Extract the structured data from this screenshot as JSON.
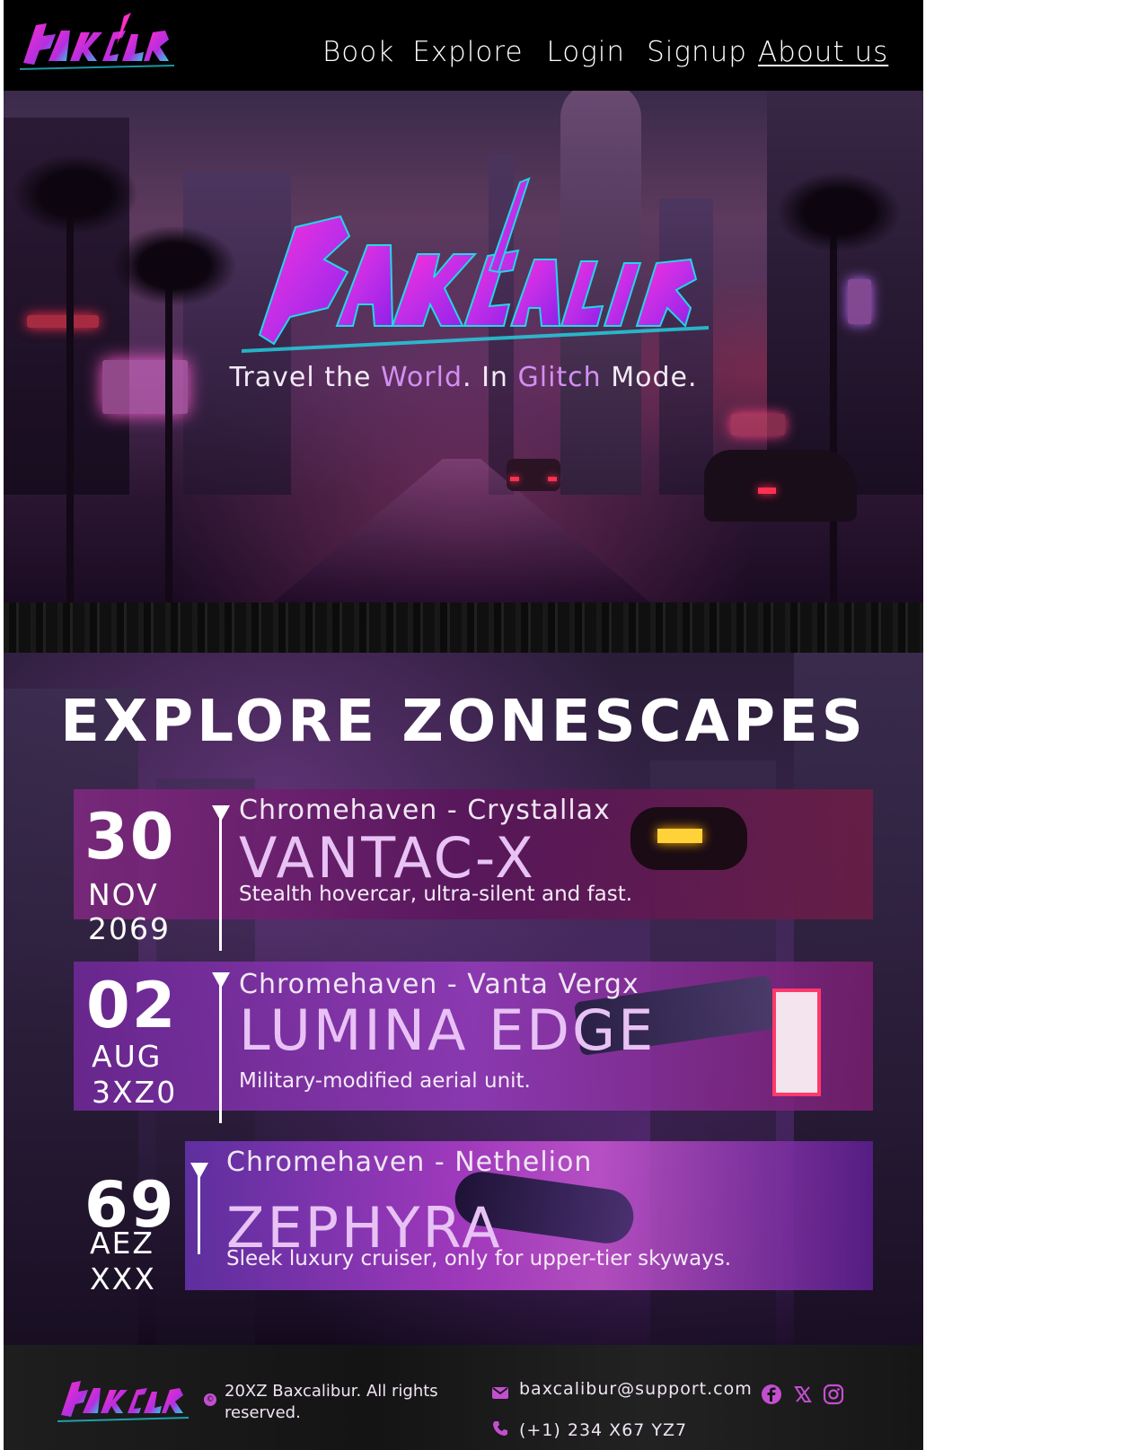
{
  "brand": {
    "name": "Baxcalibur"
  },
  "nav": {
    "items": [
      {
        "label": "Book"
      },
      {
        "label": "Explore"
      },
      {
        "label": "Login"
      },
      {
        "label": "Signup"
      },
      {
        "label": "About us",
        "active": true
      }
    ]
  },
  "hero": {
    "tagline_part1": "Travel the ",
    "tagline_highlight1": "World",
    "tagline_part2": ". In ",
    "tagline_highlight2": "Glitch",
    "tagline_part3": " Mode."
  },
  "explore": {
    "title": "EXPLORE ZONESCAPES",
    "cards": [
      {
        "day": "30",
        "month": "NOV",
        "year": "2069",
        "location": "Chromehaven - Crystallax",
        "name": "VANTAC-X",
        "description": "Stealth hovercar, ultra-silent and fast."
      },
      {
        "day": "02",
        "month": "AUG",
        "year": "3XZ0",
        "location": "Chromehaven - Vanta Vergx",
        "name": "LUMINA EDGE",
        "description": "Military-modified aerial unit."
      },
      {
        "day": "69",
        "month": "AEZ",
        "year": "XXX",
        "location": "Chromehaven - Nethelion",
        "name": "ZEPHYRA",
        "description": "Sleek luxury cruiser, only for upper-tier skyways."
      }
    ]
  },
  "footer": {
    "copyright_symbol": "©",
    "copyright": "20XZ Baxcalibur. All rights reserved.",
    "email": "baxcalibur@support.com",
    "phone": "(+1) 234 X67 YZ7",
    "social": [
      {
        "icon": "facebook-icon"
      },
      {
        "icon": "x-icon"
      },
      {
        "icon": "instagram-icon"
      }
    ]
  },
  "colors": {
    "accent": "#d48ef2",
    "name_text": "#e8c2f5",
    "logo_pink": "#ff2fc8",
    "logo_cyan": "#21d7e6",
    "social": "#c34fd0"
  }
}
